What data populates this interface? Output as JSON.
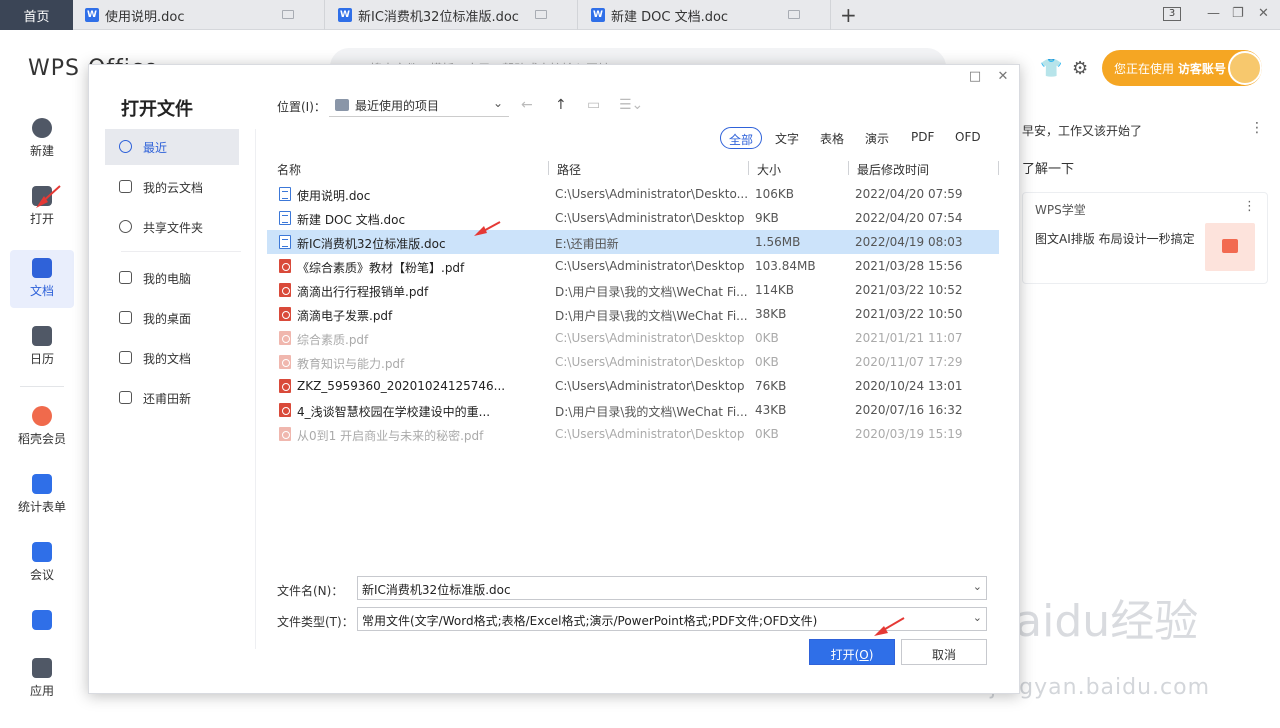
{
  "tabs": {
    "home": "首页",
    "docs": [
      "使用说明.doc",
      "新IC消费机32位标准版.doc",
      "新建 DOC 文档.doc"
    ],
    "add": "+",
    "count": "3",
    "minimize": "—",
    "restore": "❐",
    "close": "✕"
  },
  "app": {
    "logo": "WPS Office",
    "search_placeholder": "搜索文件、模板、应用、帮助或直接输入网址"
  },
  "nav": {
    "new": "新建",
    "open": "打开",
    "docs": "文档",
    "calendar": "日历",
    "member": "稻壳会员",
    "forms": "统计表单",
    "meeting": "会议",
    "apps": "应用"
  },
  "account": {
    "prefix": "您正在使用",
    "name": "访客账号"
  },
  "right_panel": {
    "greeting": "早安，工作又该开始了",
    "more": "⋮",
    "learn": "了解一下",
    "card_title": "WPS学堂",
    "card_text": "图文AI排版 布局设计一秒搞定"
  },
  "dialog": {
    "title": "打开文件",
    "location_label": "位置(I)：",
    "location_value": "最近使用的项目",
    "sidebar": [
      "最近",
      "我的云文档",
      "共享文件夹",
      "我的电脑",
      "我的桌面",
      "我的文档",
      "还甫田新"
    ],
    "filters": [
      "全部",
      "文字",
      "表格",
      "演示",
      "PDF",
      "OFD"
    ],
    "columns": {
      "name": "名称",
      "path": "路径",
      "size": "大小",
      "date": "最后修改时间"
    },
    "files": [
      {
        "name": "使用说明.doc",
        "path": "C:\\Users\\Administrator\\Deskto...",
        "size": "106KB",
        "date": "2022/04/20 07:59",
        "type": "doc",
        "faded": false,
        "selected": false
      },
      {
        "name": "新建 DOC 文档.doc",
        "path": "C:\\Users\\Administrator\\Desktop",
        "size": "9KB",
        "date": "2022/04/20 07:54",
        "type": "doc",
        "faded": false,
        "selected": false
      },
      {
        "name": "新IC消费机32位标准版.doc",
        "path": "E:\\还甫田新",
        "size": "1.56MB",
        "date": "2022/04/19 08:03",
        "type": "doc",
        "faded": false,
        "selected": true
      },
      {
        "name": "《综合素质》教材【粉笔】.pdf",
        "path": "C:\\Users\\Administrator\\Desktop",
        "size": "103.84MB",
        "date": "2021/03/28 15:56",
        "type": "pdf",
        "faded": false,
        "selected": false
      },
      {
        "name": "滴滴出行行程报销单.pdf",
        "path": "D:\\用户目录\\我的文档\\WeChat Fi...",
        "size": "114KB",
        "date": "2021/03/22 10:52",
        "type": "pdf",
        "faded": false,
        "selected": false
      },
      {
        "name": "滴滴电子发票.pdf",
        "path": "D:\\用户目录\\我的文档\\WeChat Fi...",
        "size": "38KB",
        "date": "2021/03/22 10:50",
        "type": "pdf",
        "faded": false,
        "selected": false
      },
      {
        "name": "综合素质.pdf",
        "path": "C:\\Users\\Administrator\\Desktop",
        "size": "0KB",
        "date": "2021/01/21 11:07",
        "type": "pdf",
        "faded": true,
        "selected": false
      },
      {
        "name": "教育知识与能力.pdf",
        "path": "C:\\Users\\Administrator\\Desktop",
        "size": "0KB",
        "date": "2020/11/07 17:29",
        "type": "pdf",
        "faded": true,
        "selected": false
      },
      {
        "name": "ZKZ_5959360_20201024125746...",
        "path": "C:\\Users\\Administrator\\Desktop",
        "size": "76KB",
        "date": "2020/10/24 13:01",
        "type": "pdf",
        "faded": false,
        "selected": false
      },
      {
        "name": "4_浅谈智慧校园在学校建设中的重...",
        "path": "D:\\用户目录\\我的文档\\WeChat Fi...",
        "size": "43KB",
        "date": "2020/07/16 16:32",
        "type": "pdf",
        "faded": false,
        "selected": false
      },
      {
        "name": "从0到1 开启商业与未来的秘密.pdf",
        "path": "C:\\Users\\Administrator\\Desktop",
        "size": "0KB",
        "date": "2020/03/19 15:19",
        "type": "pdf",
        "faded": true,
        "selected": false
      }
    ],
    "filename_label": "文件名(N)：",
    "filename_value": "新IC消费机32位标准版.doc",
    "filetype_label": "文件类型(T)：",
    "filetype_value": "常用文件(文字/Word格式;表格/Excel格式;演示/PowerPoint格式;PDF文件;OFD文件)",
    "open_btn": "打开(",
    "open_btn_key": "O",
    "open_btn_end": ")",
    "cancel_btn": "取消",
    "max": "□",
    "close": "✕"
  },
  "watermark": {
    "main": "Baidu经验",
    "sub": "jingyan.baidu.com"
  },
  "colors": {
    "accent": "#2f6fe8",
    "selected_row": "#cce3fa",
    "annotation_arrow": "#e53935",
    "guest_btn": "#f5a623"
  }
}
